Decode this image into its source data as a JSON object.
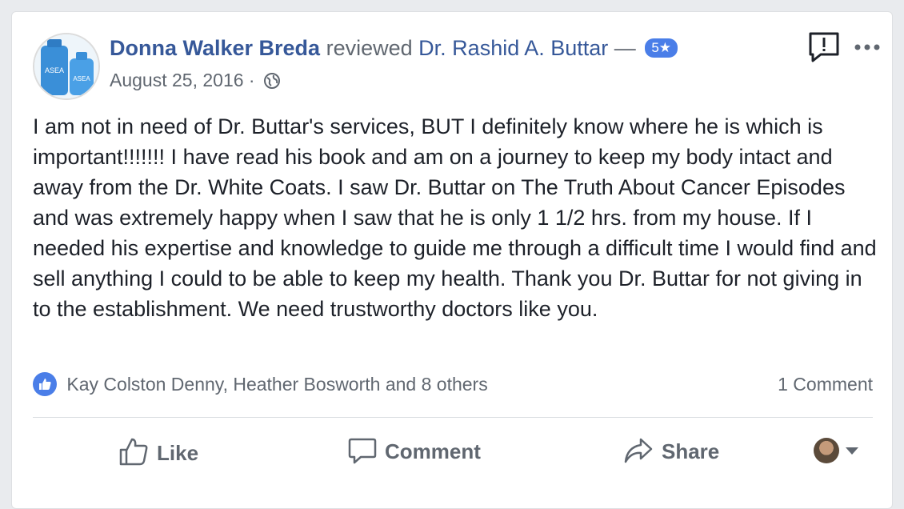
{
  "post": {
    "author": "Donna Walker Breda",
    "action": "reviewed",
    "page": "Dr. Rashid A. Buttar",
    "dash": "—",
    "rating": "5",
    "star": "★",
    "date": "August 25, 2016",
    "separator": "·",
    "avatar_text": [
      "ASEA",
      "ASEA"
    ],
    "body": "I am not in need of Dr. Buttar's services, BUT I definitely know where he is which is important!!!!!!! I have read his book and am on a journey to keep my body intact and away from the Dr. White Coats. I saw Dr. Buttar on The Truth About Cancer Episodes and was extremely happy when I saw that he is only 1 1/2 hrs. from my house. If I needed his expertise and knowledge to guide me through a difficult time I would find and sell anything I could to be able to keep my health. Thank you Dr. Buttar for not giving in to the establishment. We need trustworthy doctors like you."
  },
  "reactions": {
    "text": "Kay Colston Denny, Heather Bosworth and 8 others",
    "comments": "1 Comment"
  },
  "actions": {
    "like": "Like",
    "comment": "Comment",
    "share": "Share"
  },
  "colors": {
    "link": "#365899",
    "meta": "#606770",
    "badge": "#4a7ee8",
    "like_blue": "#4a7ee8"
  },
  "icons": [
    "globe-icon",
    "report-icon",
    "more-icon",
    "like-bubble-icon",
    "thumbs-up-icon",
    "comment-icon",
    "share-icon",
    "chevron-down-icon"
  ]
}
